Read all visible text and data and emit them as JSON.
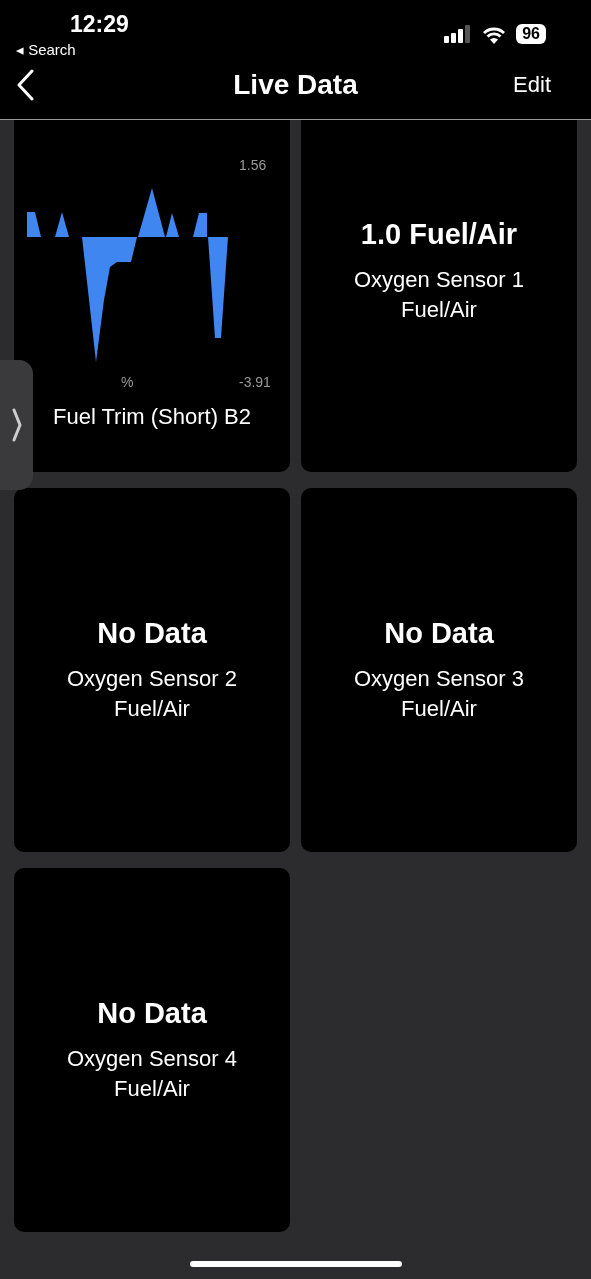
{
  "status_bar": {
    "time": "12:29",
    "back_link": "◂ Search",
    "battery": "96"
  },
  "nav": {
    "title": "Live Data",
    "edit": "Edit"
  },
  "tiles": [
    {
      "kind": "chart",
      "max": "1.56",
      "unit": "%",
      "min": "-3.91",
      "label": "Fuel Trim (Short) B2"
    },
    {
      "kind": "value",
      "value": "1.0 Fuel/Air",
      "label": "Oxygen Sensor 1\nFuel/Air"
    },
    {
      "kind": "value",
      "value": "No Data",
      "label": "Oxygen Sensor 2\nFuel/Air"
    },
    {
      "kind": "value",
      "value": "No Data",
      "label": "Oxygen Sensor 3\nFuel/Air"
    },
    {
      "kind": "value",
      "value": "No Data",
      "label": "Oxygen Sensor 4\nFuel/Air"
    }
  ]
}
